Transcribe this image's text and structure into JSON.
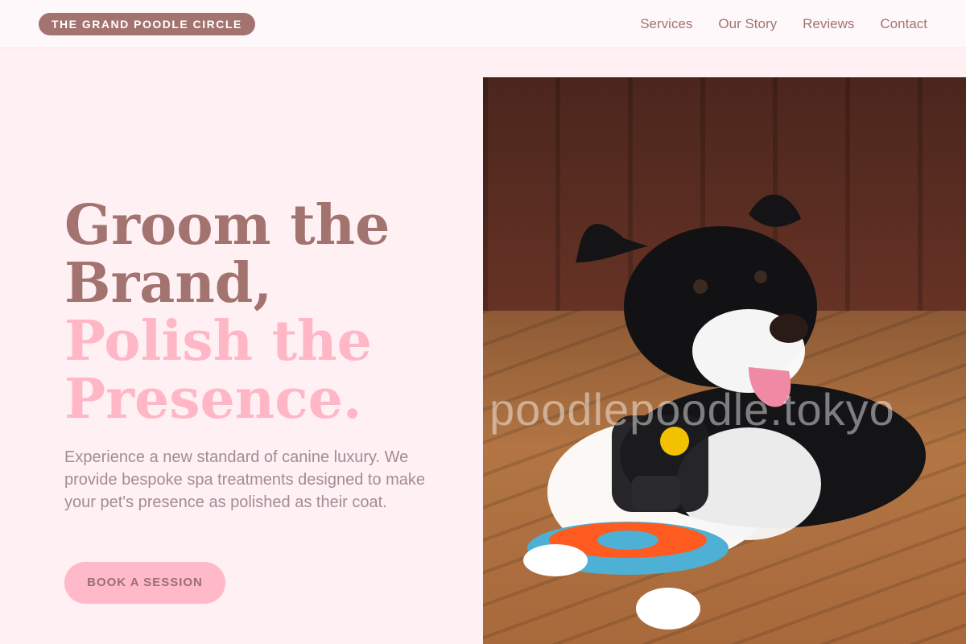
{
  "header": {
    "brand": "THE GRAND POODLE CIRCLE",
    "nav": [
      "Services",
      "Our Story",
      "Reviews",
      "Contact"
    ]
  },
  "hero": {
    "headline_line1": "Groom the",
    "headline_line2": "Brand,",
    "headline_line3": "Polish the",
    "headline_line4": "Presence.",
    "subcopy": "Experience a new standard of canine luxury. We provide bespoke spa treatments designed to make your pet's presence as polished as their coat.",
    "cta": "BOOK A SESSION"
  },
  "image": {
    "watermark": "poodlepoodle.tokyo"
  },
  "colors": {
    "accent_brown": "#a3736f",
    "accent_pink": "#ffb7c6",
    "background": "#fff0f4"
  },
  "icons": {
    "dog_photo": "dog-photo-icon"
  }
}
